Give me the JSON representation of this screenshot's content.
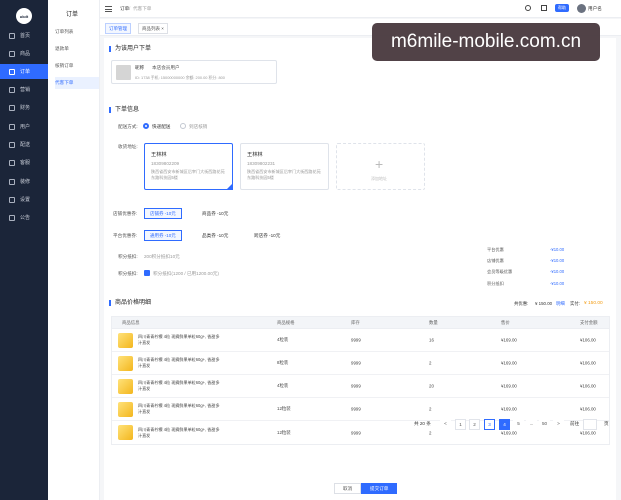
{
  "sidebar": {
    "logo": "ukdt",
    "items": [
      "首页",
      "商品",
      "订单",
      "营销",
      "财务",
      "用户",
      "配送",
      "客服",
      "装修",
      "设置",
      "公告"
    ],
    "active": 2
  },
  "subnav": {
    "title": "订单",
    "items": [
      "订单列表",
      "退款单",
      "核销订单",
      "代客下单"
    ],
    "active": 3
  },
  "topbar": {
    "breadcrumb_home": "订单",
    "breadcrumb_current": "代客下单",
    "badge": "帮助",
    "user": "用户名"
  },
  "tabs": [
    {
      "label": "订单管理"
    },
    {
      "label": "商品列表"
    }
  ],
  "customer": {
    "section_title": "为该用户下单",
    "name": "昵称",
    "id": "本店会员用户",
    "meta": "ID: 1738   手机: 15000000000   余额: 200.00   积分: 800"
  },
  "order_info": {
    "section_title": "下单信息",
    "delivery_label": "配送方式:",
    "delivery_options": [
      "快递配送",
      "到店核销"
    ],
    "address_label": "收货地址:",
    "addresses": [
      {
        "name": "王林林",
        "phone": "18309802209",
        "addr": "陕西省西安市新城区后宰门大街西路花苑东路科技园5楼"
      },
      {
        "name": "王林林",
        "phone": "18309802231",
        "addr": "陕西省西安市新城区后宰门大街西路花苑东路科技园5楼"
      }
    ],
    "add_address": "添加地址",
    "coupon_label": "店铺优惠券:",
    "coupon_btn": "店铺券 -10元",
    "coupon_sub": "商品券 -10元",
    "platform_label": "平台优惠券:",
    "platform_btn": "通用券 -10元",
    "platform_sub1": "品类券 -10元",
    "platform_sub2": "跨店券 -10元",
    "points_label": "积分抵扣:",
    "points_value": "200积分抵扣10元",
    "points2_label": "积分抵扣:",
    "points2_value": "积分抵扣(1200 / 已用1200.00元)"
  },
  "summary": [
    {
      "label": "平台优惠",
      "value": "-¥10.00"
    },
    {
      "label": "店铺优惠",
      "value": "-¥10.00"
    },
    {
      "label": "会员等级优惠",
      "value": "-¥10.00"
    },
    {
      "label": "积分抵扣",
      "value": "-¥10.00"
    }
  ],
  "goods": {
    "section_title": "商品价格明细",
    "total_label": "共优惠:",
    "total_value": "¥ 150.00",
    "total_note": "明细",
    "pay_label": "实付:",
    "pay_value": "¥ 150.00",
    "columns": [
      "商品信息",
      "商品规格",
      "库存",
      "数量",
      "售价",
      "支付金额"
    ],
    "rows": [
      {
        "name": "四川青青柠檬 4粒 现摘鲜果单粒60g+, 香甜多汁直发",
        "spec": "4粒装",
        "stock": "9999",
        "qty": "16",
        "price": "¥169.00",
        "pay": "¥106.00"
      },
      {
        "name": "四川青青柠檬 4粒 现摘鲜果单粒60g+, 香甜多汁直发",
        "spec": "8粒装",
        "stock": "9999",
        "qty": "2",
        "price": "¥169.00",
        "pay": "¥106.00"
      },
      {
        "name": "四川青青柠檬 4粒 现摘鲜果单粒60g+, 香甜多汁直发",
        "spec": "4粒装",
        "stock": "9999",
        "qty": "20",
        "price": "¥169.00",
        "pay": "¥106.00"
      },
      {
        "name": "四川青青柠檬 4粒 现摘鲜果单粒60g+, 香甜多汁直发",
        "spec": "12粒装",
        "stock": "9999",
        "qty": "2",
        "price": "¥169.00",
        "pay": "¥106.00"
      },
      {
        "name": "四川青青柠檬 4粒 现摘鲜果单粒60g+, 香甜多汁直发",
        "spec": "12粒装",
        "stock": "9999",
        "qty": "2",
        "price": "¥169.00",
        "pay": "¥106.00"
      }
    ]
  },
  "pagination": {
    "total": "共 20 条",
    "pages": [
      "<",
      "1",
      "2",
      "3",
      "4",
      "5",
      "...",
      "50",
      ">"
    ],
    "current": "4",
    "goto_label": "前往",
    "page_unit": "页"
  },
  "footer": {
    "cancel": "取消",
    "submit": "提交订单"
  },
  "watermark": "m6mile-mobile.com.cn"
}
